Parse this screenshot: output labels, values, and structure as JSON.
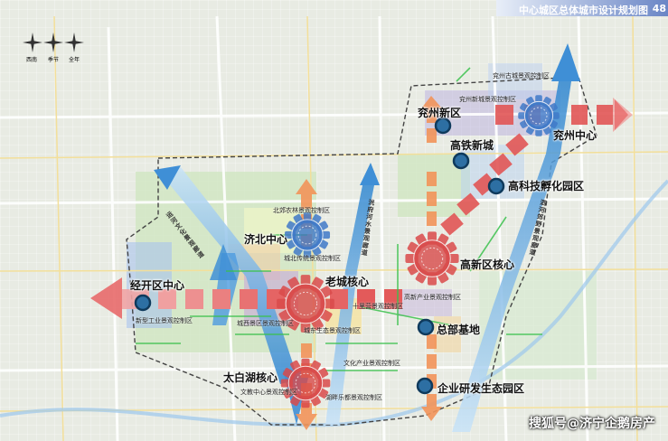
{
  "header": {
    "title": "中心城区总体城市设计规划图",
    "page": "48"
  },
  "watermark": "搜狐号@济宁企鹅房产",
  "major_labels": {
    "yanzhou_xinqu": "兖州新区",
    "gaotie_xincheng": "高铁新城",
    "gaoke_fuhua": "高科技孵化园区",
    "yanzhou_zhongxin": "兖州中心",
    "jibei_zhongxin": "济北中心",
    "gaoxin_hexin": "高新区核心",
    "jingkai_zhongxin": "经开区中心",
    "laocheng_hexin": "老城核心",
    "zongbu_jidi": "总部基地",
    "taibaihu_hexin": "太白湖核心",
    "qiye_yanfa": "企业研发生态园区"
  },
  "district_labels": [
    "北郊农林景观控制区",
    "城北传统景观控制区",
    "城西景区景观控制区",
    "城东生态景观控制区",
    "十里营景观控制区",
    "高新产业景观控制区",
    "新型工业景观控制区",
    "文化产业景观控制区",
    "文教中心景观控制区",
    "湖畔乐都景观控制区",
    "兖州古城景观控制区",
    "兖州新城景观控制区"
  ],
  "corridor_labels": [
    "运河文化景观廊道",
    "洸府河水景观廊道",
    "泗河郊野景观廊道"
  ],
  "compass": {
    "labels": [
      "西南",
      "季节",
      "全年"
    ]
  },
  "colors": {
    "axis_red": "#e24f4f",
    "axis_blue": "#3a8fd6",
    "core_red": "#d94a4a",
    "core_blue": "#3f79c8",
    "orange_axis": "#f08a4e",
    "green_link": "#34c44a",
    "title_bar": "#6a86c6"
  }
}
